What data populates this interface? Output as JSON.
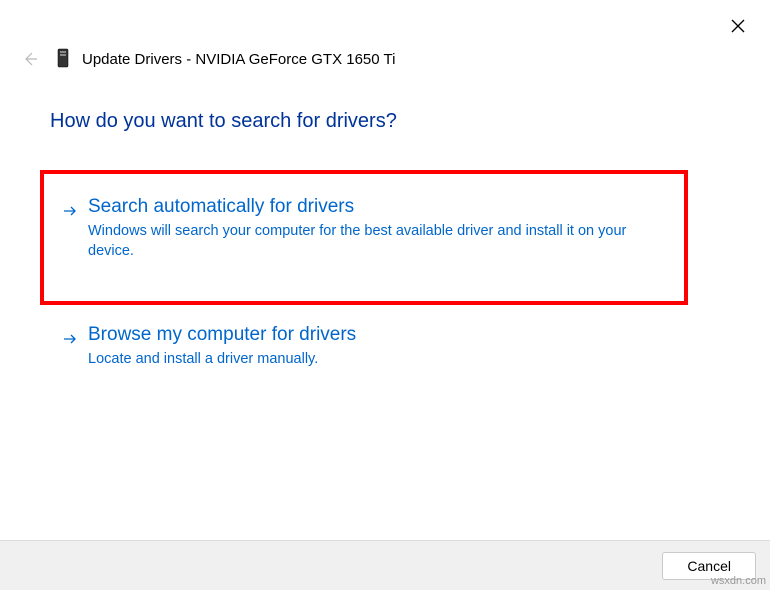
{
  "header": {
    "title": "Update Drivers - NVIDIA GeForce GTX 1650 Ti"
  },
  "question": "How do you want to search for drivers?",
  "options": {
    "auto": {
      "title": "Search automatically for drivers",
      "desc": "Windows will search your computer for the best available driver and install it on your device."
    },
    "browse": {
      "title": "Browse my computer for drivers",
      "desc": "Locate and install a driver manually."
    }
  },
  "footer": {
    "cancel": "Cancel"
  },
  "watermark": "wsxdn.com"
}
